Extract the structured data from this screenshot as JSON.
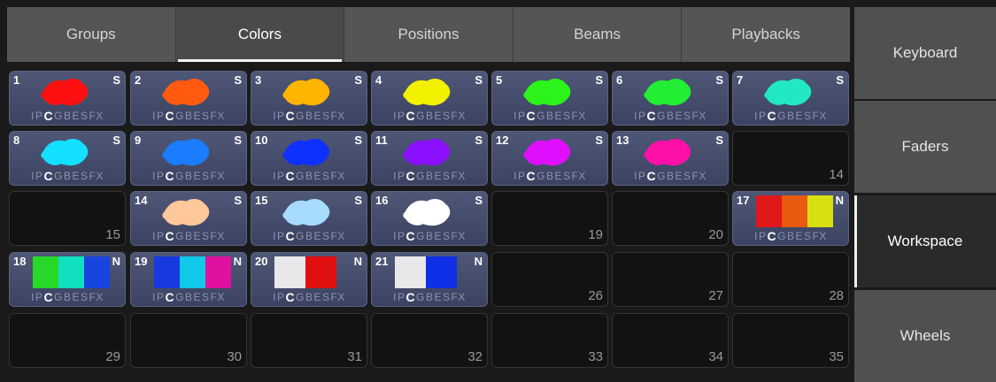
{
  "tabs": [
    {
      "label": "Groups",
      "active": false
    },
    {
      "label": "Colors",
      "active": true
    },
    {
      "label": "Positions",
      "active": false
    },
    {
      "label": "Beams",
      "active": false
    },
    {
      "label": "Playbacks",
      "active": false
    }
  ],
  "side": [
    {
      "label": "Keyboard",
      "active": false
    },
    {
      "label": "Faders",
      "active": false
    },
    {
      "label": "Workspace",
      "active": true
    },
    {
      "label": "Wheels",
      "active": false
    }
  ],
  "attr_letters": [
    "I",
    "P",
    "C",
    "G",
    "B",
    "E",
    "S",
    "FX"
  ],
  "active_attr": "C",
  "cells": [
    {
      "n": "1",
      "flag": "S",
      "colors": [
        "#ff1010"
      ]
    },
    {
      "n": "2",
      "flag": "S",
      "colors": [
        "#ff5a10"
      ]
    },
    {
      "n": "3",
      "flag": "S",
      "colors": [
        "#ffb400"
      ]
    },
    {
      "n": "4",
      "flag": "S",
      "colors": [
        "#f2f200"
      ]
    },
    {
      "n": "5",
      "flag": "S",
      "colors": [
        "#2cf41a"
      ]
    },
    {
      "n": "6",
      "flag": "S",
      "colors": [
        "#22ee33"
      ]
    },
    {
      "n": "7",
      "flag": "S",
      "colors": [
        "#22e8c2"
      ]
    },
    {
      "n": "8",
      "flag": "S",
      "colors": [
        "#13e0ff"
      ]
    },
    {
      "n": "9",
      "flag": "S",
      "colors": [
        "#1a7cff"
      ]
    },
    {
      "n": "10",
      "flag": "S",
      "colors": [
        "#1030ff"
      ]
    },
    {
      "n": "11",
      "flag": "S",
      "colors": [
        "#8a10ff"
      ]
    },
    {
      "n": "12",
      "flag": "S",
      "colors": [
        "#e010ff"
      ]
    },
    {
      "n": "13",
      "flag": "S",
      "colors": [
        "#ff10a8"
      ]
    },
    {
      "n": "14"
    },
    {
      "n": "15"
    },
    {
      "n": "14",
      "flag": "S",
      "colors": [
        "#ffc89a"
      ]
    },
    {
      "n": "15",
      "flag": "S",
      "colors": [
        "#a8dcff"
      ]
    },
    {
      "n": "16",
      "flag": "S",
      "colors": [
        "#ffffff"
      ]
    },
    {
      "n": "19"
    },
    {
      "n": "20"
    },
    {
      "n": "17",
      "flag": "N",
      "colors": [
        "#e01818",
        "#e85a10",
        "#d8e010"
      ],
      "blocks": true
    },
    {
      "n": "18",
      "flag": "N",
      "colors": [
        "#28d828",
        "#10e0c0",
        "#1844e0"
      ],
      "blocks": true
    },
    {
      "n": "19",
      "flag": "N",
      "colors": [
        "#1838e0",
        "#10c8e8",
        "#e010a0"
      ],
      "blocks": true
    },
    {
      "n": "20",
      "flag": "N",
      "colors": [
        "#e8e8ea",
        "#e01010"
      ],
      "blocks": true
    },
    {
      "n": "21",
      "flag": "N",
      "colors": [
        "#e8e8ea",
        "#1030e8"
      ],
      "blocks": true
    },
    {
      "n": "26"
    },
    {
      "n": "27"
    },
    {
      "n": "28"
    },
    {
      "n": "29"
    },
    {
      "n": "30"
    },
    {
      "n": "31"
    },
    {
      "n": "32"
    },
    {
      "n": "33"
    },
    {
      "n": "34"
    },
    {
      "n": "35"
    }
  ]
}
